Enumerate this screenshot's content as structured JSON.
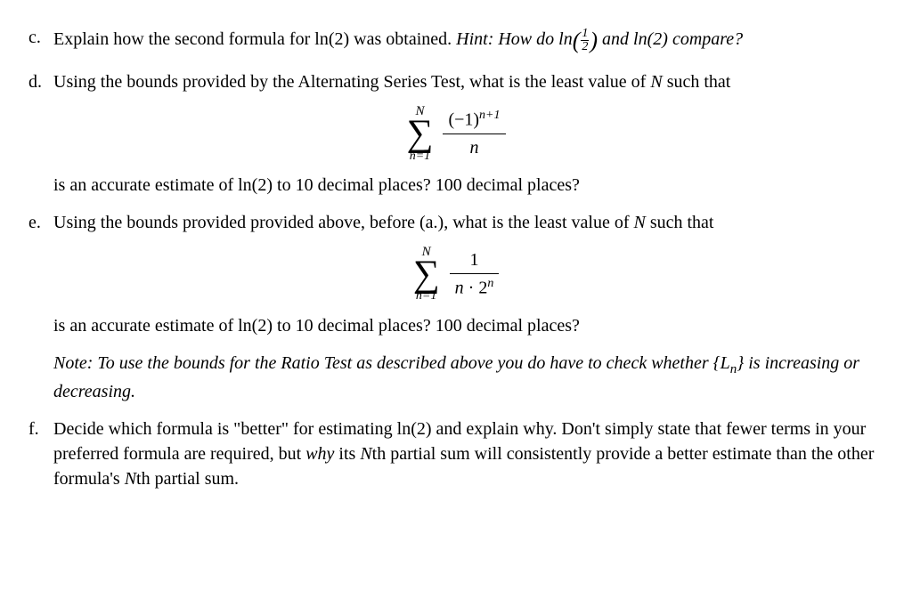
{
  "c": {
    "label": "c.",
    "text_1": "Explain how the second formula for ",
    "ln2": "ln(2)",
    "text_2": " was obtained. ",
    "hint_pre": "Hint: How do ",
    "ln_half_pre": "ln",
    "half_n": "1",
    "half_d": "2",
    "hint_mid": " and ",
    "hint_ln2": "ln(2)",
    "hint_post": " compare?"
  },
  "d": {
    "label": "d.",
    "text": "Using the bounds provided by the Alternating Series Test, what is the least value of ",
    "N": "N",
    "text_end": " such that",
    "sigma_top": "N",
    "sigma_bot": "n=1",
    "num": "(−1)",
    "num_exp": "n+1",
    "den": "n",
    "after_1": "is an accurate estimate of ",
    "after_ln2": "ln(2)",
    "after_2": " to 10 decimal places? 100 decimal places?"
  },
  "e": {
    "label": "e.",
    "text": "Using the bounds provided provided above, before (a.), what is the least value of ",
    "N": "N",
    "text_end": " such that",
    "sigma_top": "N",
    "sigma_bot": "n=1",
    "num": "1",
    "den_n": "n",
    "den_dot": " · ",
    "den_base": "2",
    "den_exp": "n",
    "after_1": "is an accurate estimate of ",
    "after_ln2": "ln(2)",
    "after_2": " to 10 decimal places? 100 decimal places?",
    "note_pre": "Note: To use the bounds for the Ratio Test as described above you do have to check whether ",
    "note_set_open": "{",
    "note_L": "L",
    "note_sub": "n",
    "note_set_close": "}",
    "note_post": " is increasing or decreasing."
  },
  "f": {
    "label": "f.",
    "t1": "Decide which formula is \"better\" for estimating ",
    "ln2": "ln(2)",
    "t2": " and explain why. Don't simply state that fewer terms in your preferred formula are required, but ",
    "why": "why",
    "t3": " its ",
    "N1": "N",
    "t4": "th partial sum will consistently provide a better estimate than the other formula's ",
    "N2": "N",
    "t5": "th partial sum."
  }
}
